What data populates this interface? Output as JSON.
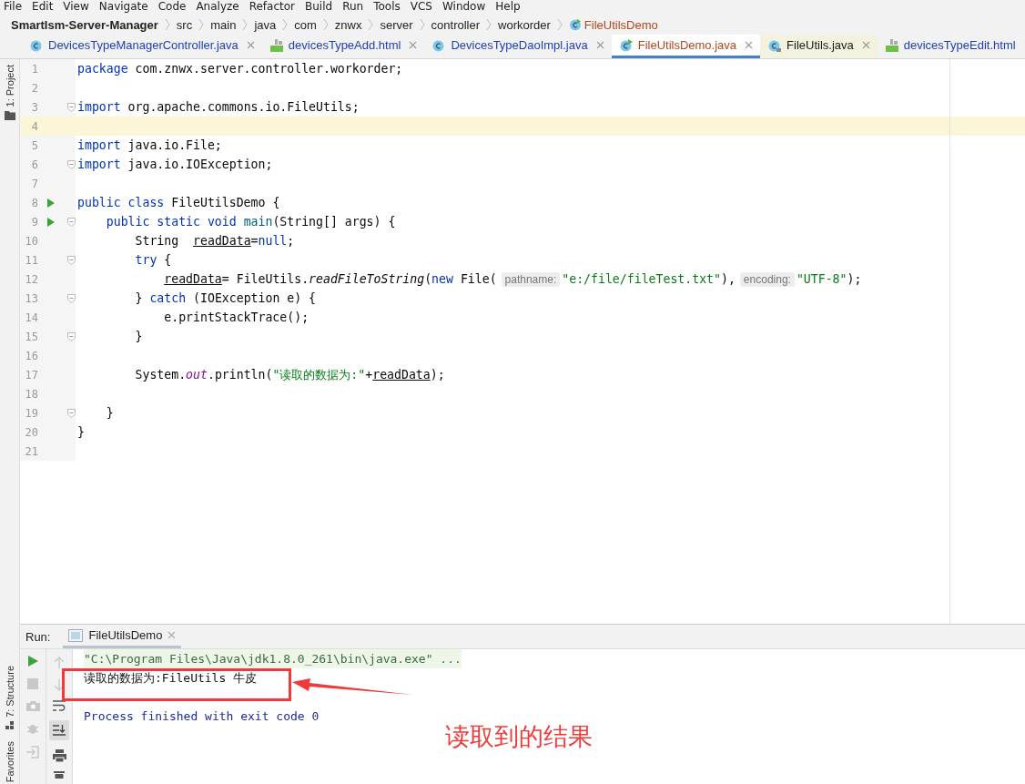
{
  "menu": [
    "File",
    "Edit",
    "View",
    "Navigate",
    "Code",
    "Analyze",
    "Refactor",
    "Build",
    "Run",
    "Tools",
    "VCS",
    "Window",
    "Help"
  ],
  "breadcrumb": {
    "project": "SmartIsm-Server-Manager",
    "path": [
      "src",
      "main",
      "java",
      "com",
      "znwx",
      "server",
      "controller",
      "workorder"
    ],
    "file": "FileUtilsDemo"
  },
  "tabs": [
    {
      "label": "DevicesTypeManagerController.java",
      "kind": "class",
      "selected": false,
      "library": false,
      "color": "#1f3fb5"
    },
    {
      "label": "devicesTypeAdd.html",
      "kind": "html",
      "selected": false,
      "library": false,
      "color": "#1f3fb5"
    },
    {
      "label": "DevicesTypeDaoImpl.java",
      "kind": "class",
      "selected": false,
      "library": false,
      "color": "#1f3fb5"
    },
    {
      "label": "FileUtilsDemo.java",
      "kind": "runnable",
      "selected": true,
      "library": false,
      "color": "#b3461d"
    },
    {
      "label": "FileUtils.java",
      "kind": "locked",
      "selected": false,
      "library": true,
      "color": "#1a1a1a"
    },
    {
      "label": "devicesTypeEdit.html",
      "kind": "html",
      "selected": false,
      "library": false,
      "color": "#1f3fb5"
    }
  ],
  "tool_strip": {
    "top": "1: Project",
    "middle": "7: Structure",
    "bottom": "Favorites"
  },
  "lines": [
    {
      "number": "1",
      "run": false,
      "fold": false,
      "current": false,
      "tokens": [
        {
          "text": "package",
          "kind": "kw"
        },
        {
          "text": " com.znwx.server.controller.workorder;",
          "kind": "plain"
        }
      ]
    },
    {
      "number": "2",
      "run": false,
      "fold": false,
      "current": false
    },
    {
      "number": "3",
      "run": false,
      "fold": true,
      "current": false,
      "tokens": [
        {
          "text": "import",
          "kind": "kw"
        },
        {
          "text": " org.apache.commons.io.FileUtils;",
          "kind": "plain"
        }
      ]
    },
    {
      "number": "4",
      "run": false,
      "fold": false,
      "current": true
    },
    {
      "number": "5",
      "run": false,
      "fold": false,
      "current": false,
      "tokens": [
        {
          "text": "import",
          "kind": "kw"
        },
        {
          "text": " java.io.File;",
          "kind": "plain"
        }
      ]
    },
    {
      "number": "6",
      "run": false,
      "fold": true,
      "current": false,
      "tokens": [
        {
          "text": "import",
          "kind": "kw"
        },
        {
          "text": " java.io.IOException;",
          "kind": "plain"
        }
      ]
    },
    {
      "number": "7",
      "run": false,
      "fold": false,
      "current": false
    },
    {
      "number": "8",
      "run": true,
      "fold": false,
      "current": false,
      "tokens": [
        {
          "text": "public class ",
          "kind": "kw"
        },
        {
          "text": "FileUtilsDemo",
          "kind": "decl"
        },
        {
          "text": " {",
          "kind": "plain"
        }
      ]
    },
    {
      "number": "9",
      "run": true,
      "fold": true,
      "current": false,
      "tokens": [
        {
          "text": "    public static void ",
          "kind": "kw"
        },
        {
          "text": "main",
          "kind": "fn"
        },
        {
          "text": "(String[] args) {",
          "kind": "plain"
        }
      ]
    },
    {
      "number": "10",
      "run": false,
      "fold": false,
      "current": false,
      "tokens": [
        {
          "text": "        String  ",
          "kind": "plain"
        },
        {
          "text": "readData",
          "kind": "var"
        },
        {
          "text": "=",
          "kind": "plain"
        },
        {
          "text": "null",
          "kind": "kw"
        },
        {
          "text": ";",
          "kind": "plain"
        }
      ]
    },
    {
      "number": "11",
      "run": false,
      "fold": true,
      "current": false,
      "tokens": [
        {
          "text": "        try",
          "kind": "kw"
        },
        {
          "text": " {",
          "kind": "plain"
        }
      ]
    },
    {
      "number": "12",
      "run": false,
      "fold": false,
      "current": false,
      "tokens": [
        {
          "text": "            readData",
          "kind": "var"
        },
        {
          "text": "= FileUtils.",
          "kind": "plain"
        },
        {
          "text": "readFileToString",
          "kind": "call"
        },
        {
          "text": "(",
          "kind": "plain"
        },
        {
          "text": "new",
          "kind": "kw"
        },
        {
          "text": " File(",
          "kind": "plain"
        },
        {
          "text": "pathname:",
          "kind": "hint"
        },
        {
          "text": "\"e:/file/fileTest.txt\"",
          "kind": "str"
        },
        {
          "text": "),",
          "kind": "plain"
        },
        {
          "text": "encoding:",
          "kind": "hint"
        },
        {
          "text": "\"UTF-8\"",
          "kind": "str"
        },
        {
          "text": ");",
          "kind": "plain"
        }
      ]
    },
    {
      "number": "13",
      "run": false,
      "fold": true,
      "current": false,
      "tokens": [
        {
          "text": "        } ",
          "kind": "plain"
        },
        {
          "text": "catch",
          "kind": "kw"
        },
        {
          "text": " (IOException e) {",
          "kind": "plain"
        }
      ]
    },
    {
      "number": "14",
      "run": false,
      "fold": false,
      "current": false,
      "tokens": [
        {
          "text": "            e.printStackTrace();",
          "kind": "plain"
        }
      ]
    },
    {
      "number": "15",
      "run": false,
      "fold": true,
      "current": false,
      "tokens": [
        {
          "text": "        }",
          "kind": "plain"
        }
      ]
    },
    {
      "number": "16",
      "run": false,
      "fold": false,
      "current": false
    },
    {
      "number": "17",
      "run": false,
      "fold": false,
      "current": false,
      "tokens": [
        {
          "text": "        System.",
          "kind": "plain"
        },
        {
          "text": "out",
          "kind": "field"
        },
        {
          "text": ".println(",
          "kind": "plain"
        },
        {
          "text": "\"读取的数据为:\"",
          "kind": "str"
        },
        {
          "text": "+",
          "kind": "plain"
        },
        {
          "text": "readData",
          "kind": "var"
        },
        {
          "text": ");",
          "kind": "plain"
        }
      ]
    },
    {
      "number": "18",
      "run": false,
      "fold": false,
      "current": false
    },
    {
      "number": "19",
      "run": false,
      "fold": true,
      "current": false,
      "tokens": [
        {
          "text": "    }",
          "kind": "plain"
        }
      ]
    },
    {
      "number": "20",
      "run": false,
      "fold": false,
      "current": false,
      "tokens": [
        {
          "text": "}",
          "kind": "plain"
        }
      ]
    },
    {
      "number": "21",
      "run": false,
      "fold": false,
      "current": false
    }
  ],
  "run_panel": {
    "label": "Run:",
    "tab": "FileUtilsDemo",
    "console": [
      {
        "text": "\"C:\\Program Files\\Java\\jdk1.8.0_261\\bin\\java.exe\" ...",
        "kind": "command"
      },
      {
        "text": "读取的数据为:FileUtils 牛皮",
        "kind": "output"
      },
      {
        "text": "Process finished with exit code 0",
        "kind": "system"
      }
    ]
  },
  "annotation": {
    "label": "读取到的结果"
  }
}
